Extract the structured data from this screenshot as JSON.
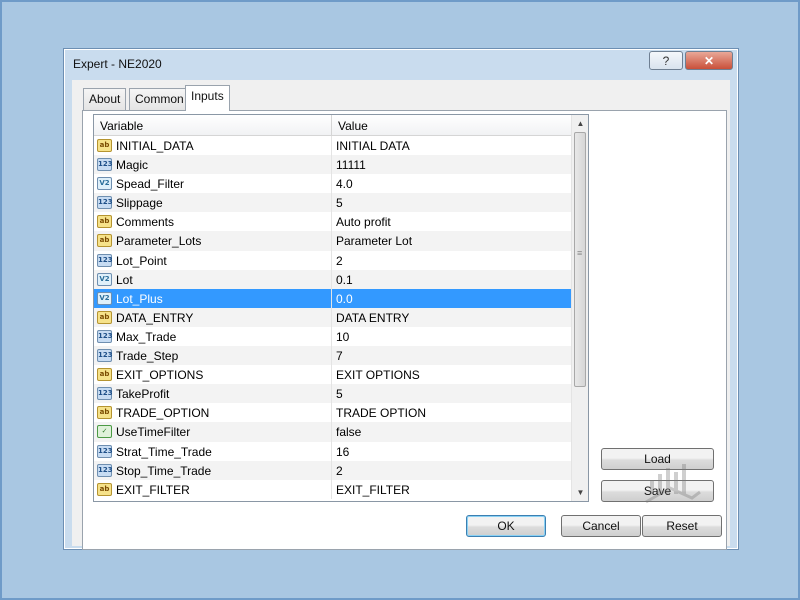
{
  "window": {
    "title": "Expert - NE2020",
    "help_label": "?",
    "close_label": "✕"
  },
  "tabs": [
    {
      "label": "About"
    },
    {
      "label": "Common"
    },
    {
      "label": "Inputs",
      "active": true
    }
  ],
  "table": {
    "columns": [
      "Variable",
      "Value"
    ],
    "rows": [
      {
        "type": "string",
        "icon": "ab",
        "variable": "INITIAL_DATA",
        "value": "INITIAL DATA"
      },
      {
        "type": "int",
        "icon": "123",
        "variable": "Magic",
        "value": "11111"
      },
      {
        "type": "double",
        "icon": "V2",
        "variable": "Spead_Filter",
        "value": "4.0"
      },
      {
        "type": "int",
        "icon": "123",
        "variable": "Slippage",
        "value": "5"
      },
      {
        "type": "string",
        "icon": "ab",
        "variable": "Comments",
        "value": "Auto profit"
      },
      {
        "type": "string",
        "icon": "ab",
        "variable": "Parameter_Lots",
        "value": "Parameter Lot"
      },
      {
        "type": "int",
        "icon": "123",
        "variable": "Lot_Point",
        "value": "2"
      },
      {
        "type": "double",
        "icon": "V2",
        "variable": "Lot",
        "value": "0.1"
      },
      {
        "type": "double",
        "icon": "V2",
        "variable": "Lot_Plus",
        "value": "0.0",
        "selected": true
      },
      {
        "type": "string",
        "icon": "ab",
        "variable": "DATA_ENTRY",
        "value": "DATA ENTRY"
      },
      {
        "type": "int",
        "icon": "123",
        "variable": "Max_Trade",
        "value": "10"
      },
      {
        "type": "int",
        "icon": "123",
        "variable": "Trade_Step",
        "value": "7"
      },
      {
        "type": "string",
        "icon": "ab",
        "variable": "EXIT_OPTIONS",
        "value": "EXIT OPTIONS"
      },
      {
        "type": "int",
        "icon": "123",
        "variable": "TakeProfit",
        "value": "5"
      },
      {
        "type": "string",
        "icon": "ab",
        "variable": "TRADE_OPTION",
        "value": "TRADE OPTION"
      },
      {
        "type": "bool",
        "icon": "✓",
        "variable": "UseTimeFilter",
        "value": "false"
      },
      {
        "type": "int",
        "icon": "123",
        "variable": "Strat_Time_Trade",
        "value": "16"
      },
      {
        "type": "int",
        "icon": "123",
        "variable": "Stop_Time_Trade",
        "value": "2"
      },
      {
        "type": "string",
        "icon": "ab",
        "variable": "EXIT_FILTER",
        "value": "EXIT_FILTER"
      }
    ]
  },
  "side_buttons": {
    "load": "Load",
    "save": "Save"
  },
  "footer_buttons": {
    "ok": "OK",
    "cancel": "Cancel",
    "reset": "Reset"
  },
  "colors": {
    "selection": "#3399ff",
    "background": "#a9c7e2",
    "dialog_frame": "#c9dcee"
  }
}
